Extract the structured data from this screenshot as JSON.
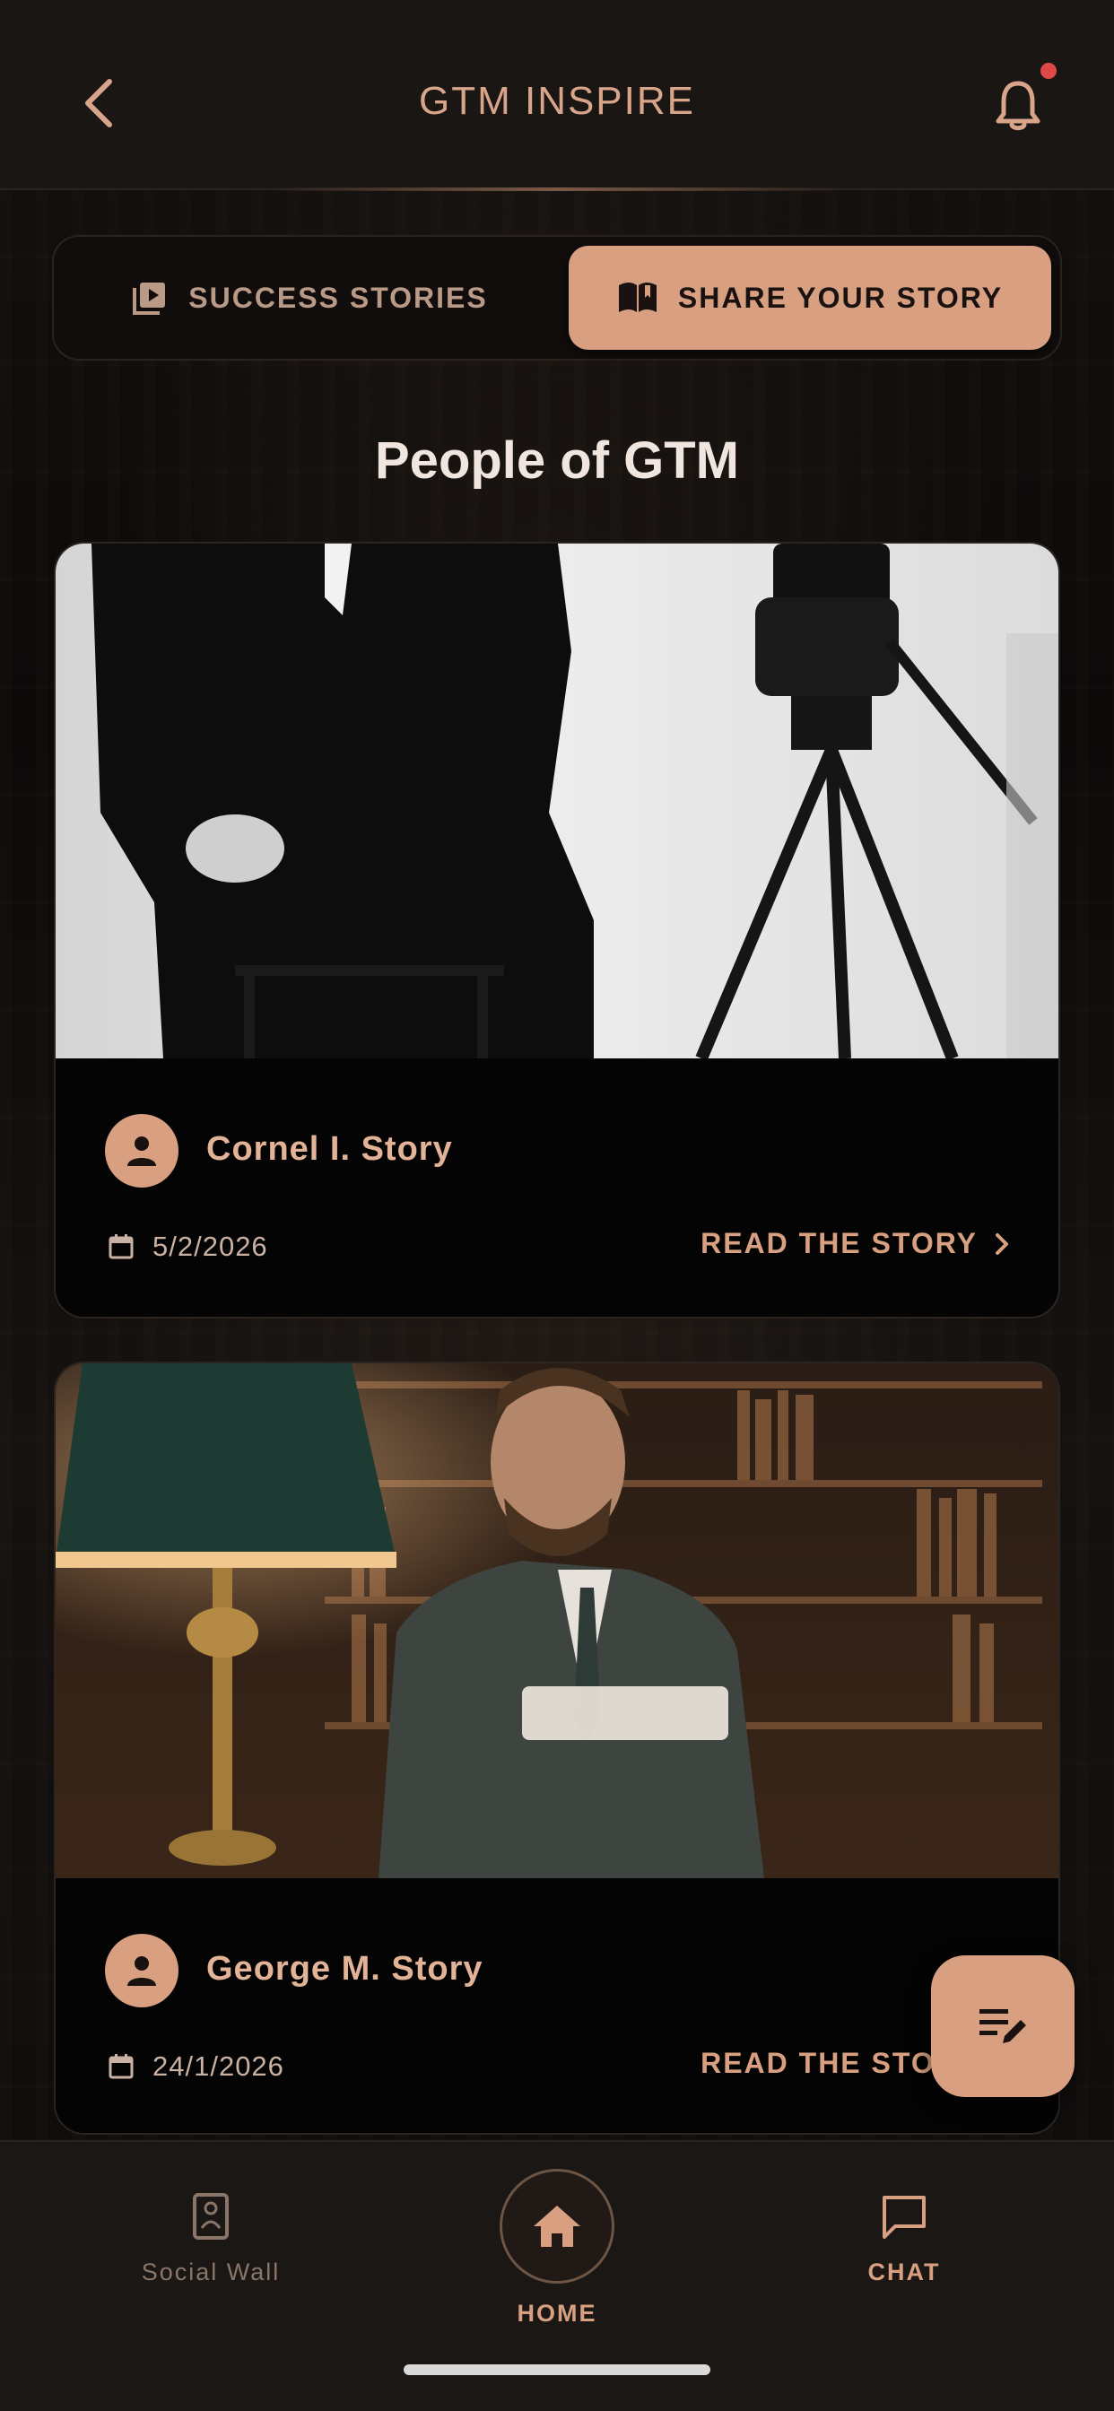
{
  "header": {
    "title": "GTM INSPIRE",
    "back_icon": "chevron-left-icon",
    "notification_icon": "bell-icon",
    "has_unread_notifications": true
  },
  "tabs": {
    "success_stories": {
      "label": "SUCCESS STORIES",
      "icon": "video-library-icon",
      "selected": false
    },
    "share_your_story": {
      "label": "SHARE YOUR STORY",
      "icon": "open-book-icon",
      "selected": true
    }
  },
  "section": {
    "title": "People of GTM"
  },
  "stories": [
    {
      "author": "Cornel I. Story",
      "date": "5/2/2026",
      "read_label": "READ THE STORY",
      "image_description_icon": "photo"
    },
    {
      "author": "George M. Story",
      "date": "24/1/2026",
      "read_label": "READ THE STORY",
      "image_description_icon": "photo"
    }
  ],
  "fab": {
    "icon": "edit-note-icon"
  },
  "bottom_nav": {
    "items": [
      {
        "label": "Social Wall",
        "icon": "social-wall-icon",
        "active": false
      },
      {
        "label": "HOME",
        "icon": "home-icon",
        "active": true
      },
      {
        "label": "CHAT",
        "icon": "chat-icon",
        "active": false
      }
    ]
  },
  "colors": {
    "accent": "#d8a080",
    "header_text": "#d8a58a",
    "background": "#0d0b0a",
    "notification_dot": "#e04848"
  }
}
